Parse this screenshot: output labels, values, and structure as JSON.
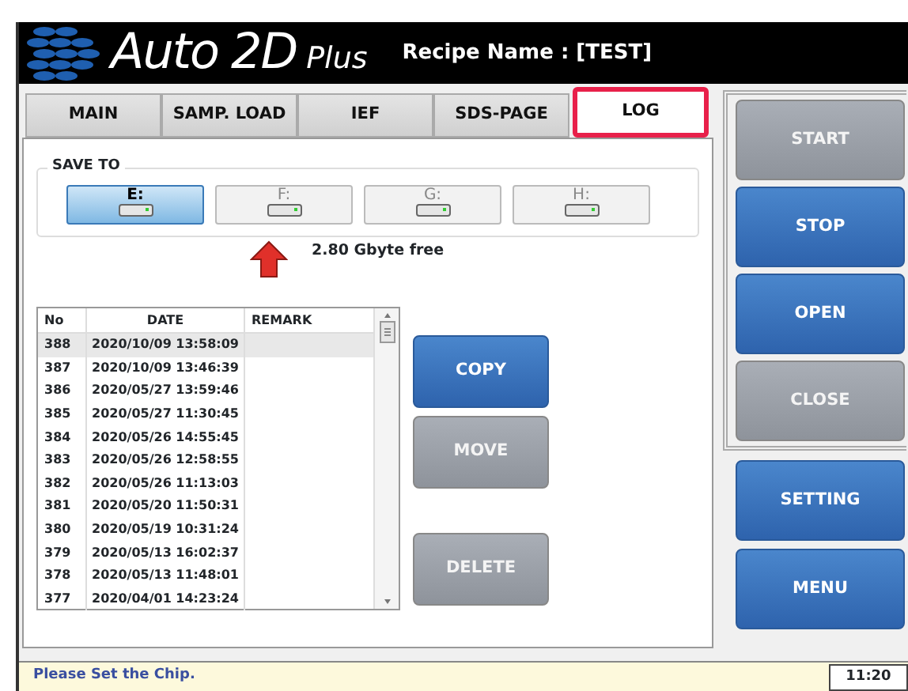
{
  "header": {
    "title": "Auto",
    "title_number": "2D",
    "subtitle": "Plus",
    "recipe": "Recipe Name : [TEST]"
  },
  "tabs": [
    {
      "label": "MAIN",
      "selected": false
    },
    {
      "label": "SAMP. LOAD",
      "selected": false
    },
    {
      "label": "IEF",
      "selected": false
    },
    {
      "label": "SDS-PAGE",
      "selected": false
    },
    {
      "label": "LOG",
      "selected": true
    }
  ],
  "save_to": {
    "legend": "SAVE TO",
    "drives": [
      {
        "label": "E:",
        "selected": true
      },
      {
        "label": "F:",
        "selected": false
      },
      {
        "label": "G:",
        "selected": false
      },
      {
        "label": "H:",
        "selected": false
      }
    ],
    "free_space": "2.80 Gbyte free"
  },
  "log_table": {
    "columns": [
      "No",
      "DATE",
      "REMARK"
    ],
    "rows": [
      {
        "no": "388",
        "date": "2020/10/09 13:58:09",
        "selected": true
      },
      {
        "no": "387",
        "date": "2020/10/09 13:46:39",
        "selected": false
      },
      {
        "no": "386",
        "date": "2020/05/27 13:59:46",
        "selected": false
      },
      {
        "no": "385",
        "date": "2020/05/27 11:30:45",
        "selected": false
      },
      {
        "no": "384",
        "date": "2020/05/26 14:55:45",
        "selected": false
      },
      {
        "no": "383",
        "date": "2020/05/26 12:58:55",
        "selected": false
      },
      {
        "no": "382",
        "date": "2020/05/26 11:13:03",
        "selected": false
      },
      {
        "no": "381",
        "date": "2020/05/20 11:50:31",
        "selected": false
      },
      {
        "no": "380",
        "date": "2020/05/19 10:31:24",
        "selected": false
      },
      {
        "no": "379",
        "date": "2020/05/13 16:02:37",
        "selected": false
      },
      {
        "no": "378",
        "date": "2020/05/13 11:48:01",
        "selected": false
      },
      {
        "no": "377",
        "date": "2020/04/01 14:23:24",
        "selected": false
      }
    ]
  },
  "log_buttons": [
    {
      "label": "COPY",
      "disabled": false
    },
    {
      "label": "MOVE",
      "disabled": true
    },
    {
      "label": "DELETE",
      "disabled": true
    }
  ],
  "control_buttons": [
    {
      "label": "START",
      "disabled": true
    },
    {
      "label": "STOP",
      "disabled": false
    },
    {
      "label": "OPEN",
      "disabled": false
    },
    {
      "label": "CLOSE",
      "disabled": true
    }
  ],
  "menu_buttons": [
    {
      "label": "SETTING",
      "disabled": false
    },
    {
      "label": "MENU",
      "disabled": false
    }
  ],
  "status_bar": {
    "message": "Please Set the Chip.",
    "time": "11:20"
  }
}
